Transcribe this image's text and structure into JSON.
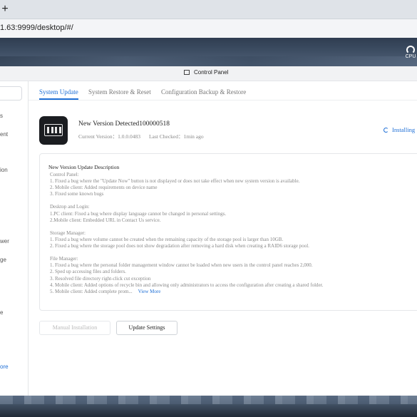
{
  "browser": {
    "newtab_glyph": "+",
    "url": "1.63:9999/desktop/#/"
  },
  "desktop": {
    "cpu_label": "CPU"
  },
  "window": {
    "title": "Control Panel"
  },
  "sidebar": {
    "items": [
      {
        "label": "s"
      },
      {
        "label": "ent"
      },
      {
        "label": "ion"
      },
      {
        "label": "wer"
      },
      {
        "label": "ge"
      },
      {
        "label": "e"
      },
      {
        "label": "ore"
      }
    ]
  },
  "tabs": [
    {
      "label": "System Update",
      "active": true
    },
    {
      "label": "System Restore & Reset",
      "active": false
    },
    {
      "label": "Configuration Backup & Restore",
      "active": false
    }
  ],
  "update": {
    "title": "New Version Detected100000518",
    "current_version": "Current Version：1.0.0.0483",
    "last_checked": "Last Checked：1min ago",
    "status": "Installing"
  },
  "description": {
    "heading": "New Version Update Description",
    "lines": [
      "Control Panel:",
      "1. Fixed a bug where the \"Update Now\" button is not displayed or does not take effect when new system version is available.",
      "2. Mobile client: Added requirements on device name",
      "3. Fixed some known bugs",
      "",
      "Desktop and Login:",
      "1.PC client: Fixed a bug where display language cannot be changed in personal settings.",
      "2.Mobile client: Embedded URL in Contact Us service.",
      "",
      "Storage Manager:",
      "1. Fixed a bug where volume cannot be created when the remaining capacity of the storage pool is larger than 10GB.",
      "2. Fixed a bug where the storage pool does not show degradation after removing a hard disk when creating a RAID6 storage pool.",
      "",
      "File Manager:",
      "1. Fixed a bug where the personal folder management window cannot be loaded when new users in the control panel reaches 2,000.",
      "2. Sped up accessing files and folders.",
      "3. Resolved file directory right-click cut exception",
      "4. Mobile client: Added options of recycle bin and allowing only administrators to access the configuration after creating a shared folder."
    ],
    "last_line": "5. Mobile client: Added complete prom...",
    "view_more": "View More"
  },
  "buttons": {
    "manual_installation": "Manual Installation",
    "update_settings": "Update Settings"
  }
}
